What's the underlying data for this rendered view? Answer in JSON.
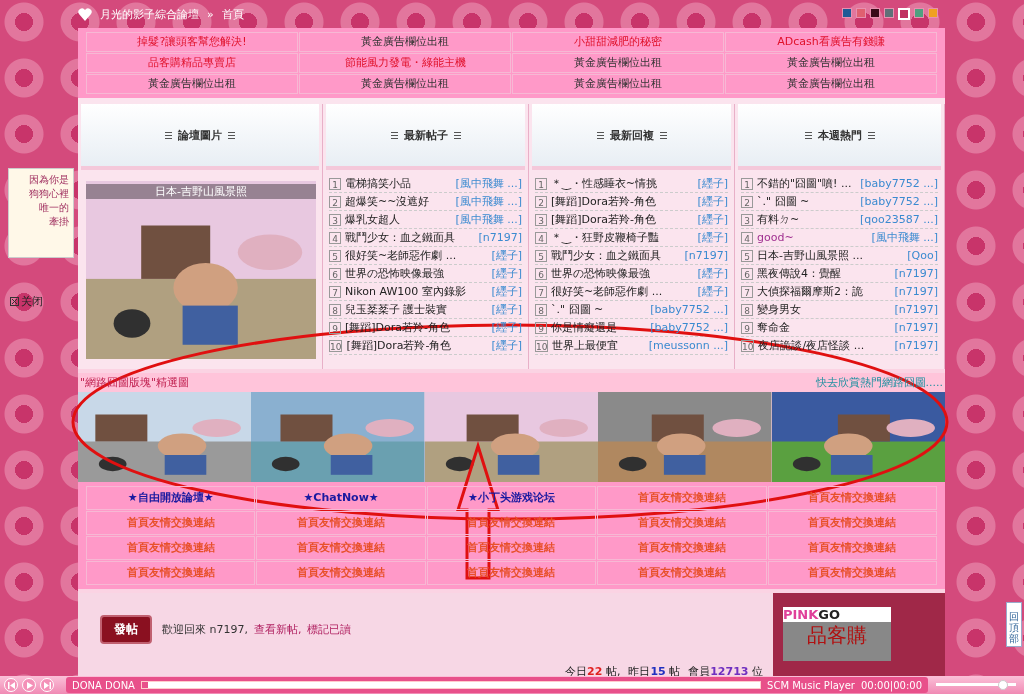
{
  "breadcrumb": {
    "site": "月光的影子綜合論壇",
    "separator": "»",
    "page": "首頁"
  },
  "swatches": [
    {
      "color": "#1f5a96",
      "selected": false
    },
    {
      "color": "#e06070",
      "selected": false
    },
    {
      "color": "#3a0a18",
      "selected": false
    },
    {
      "color": "#607078",
      "selected": false
    },
    {
      "color": "#c03060",
      "selected": true
    },
    {
      "color": "#50a080",
      "selected": false
    },
    {
      "color": "#f0a020",
      "selected": false
    }
  ],
  "ads": [
    {
      "text": "掉髮?讓頭客幫您解決!",
      "highlight": true
    },
    {
      "text": "黃金廣告欄位出租",
      "highlight": false
    },
    {
      "text": "小甜甜減肥的秘密",
      "highlight": true
    },
    {
      "text": "ADcash看廣告有錢賺",
      "highlight": true
    },
    {
      "text": "品客購精品專賣店",
      "highlight": true
    },
    {
      "text": "節能風力發電・綠能主機",
      "highlight": true
    },
    {
      "text": "黃金廣告欄位出租",
      "highlight": false
    },
    {
      "text": "黃金廣告欄位出租",
      "highlight": false
    },
    {
      "text": "黃金廣告欄位出租",
      "highlight": false
    },
    {
      "text": "黃金廣告欄位出租",
      "highlight": false
    },
    {
      "text": "黃金廣告欄位出租",
      "highlight": false
    },
    {
      "text": "黃金廣告欄位出租",
      "highlight": false
    }
  ],
  "float_ad": {
    "lines": [
      "因為你是",
      "狗狗心裡",
      "唯一的",
      "牽掛"
    ],
    "close": "关闭"
  },
  "photo_panel": {
    "title": "論壇圖片",
    "caption": "日本-吉野山風景照"
  },
  "lists": [
    {
      "title": "最新帖子",
      "items": [
        {
          "rank": "1",
          "title": "電梯搞笑小品",
          "author": "[風中飛舞 ...]",
          "visited": false
        },
        {
          "rank": "2",
          "title": "超爆笑~~沒遮好",
          "author": "[風中飛舞 ...]",
          "visited": false
        },
        {
          "rank": "3",
          "title": "爆乳女超人",
          "author": "[風中飛舞 ...]",
          "visited": false
        },
        {
          "rank": "4",
          "title": "戰鬥少女：血之鐵面具",
          "author": "[n7197]",
          "visited": false
        },
        {
          "rank": "5",
          "title": "很好笑~老師惡作劇 ...",
          "author": "[纆子]",
          "visited": false
        },
        {
          "rank": "6",
          "title": "世界の恐怖映像最強",
          "author": "[纆子]",
          "visited": false
        },
        {
          "rank": "7",
          "title": "Nikon AW100 室內錄影",
          "author": "[纆子]",
          "visited": false
        },
        {
          "rank": "8",
          "title": "兒玉棻棻子 護士裝實",
          "author": "[纆子]",
          "visited": false
        },
        {
          "rank": "9",
          "title": "[舞蹈]Dora若羚-角色",
          "author": "[纆子]",
          "visited": false
        },
        {
          "rank": "10",
          "title": "[舞蹈]Dora若羚-角色",
          "author": "[纆子]",
          "visited": false
        }
      ]
    },
    {
      "title": "最新回複",
      "items": [
        {
          "rank": "1",
          "title": "＊‿・性感睡衣~情挑",
          "author": "[纆子]",
          "visited": false
        },
        {
          "rank": "2",
          "title": "[舞蹈]Dora若羚-角色",
          "author": "[纆子]",
          "visited": false
        },
        {
          "rank": "3",
          "title": "[舞蹈]Dora若羚-角色",
          "author": "[纆子]",
          "visited": false
        },
        {
          "rank": "4",
          "title": "＊‿・狂野皮鞭椅子豔",
          "author": "[纆子]",
          "visited": false
        },
        {
          "rank": "5",
          "title": "戰鬥少女：血之鐵面具",
          "author": "[n7197]",
          "visited": false
        },
        {
          "rank": "6",
          "title": "世界の恐怖映像最強",
          "author": "[纆子]",
          "visited": false
        },
        {
          "rank": "7",
          "title": "很好笑~老師惡作劇 ...",
          "author": "[纆子]",
          "visited": false
        },
        {
          "rank": "8",
          "title": "`.\" 囧圖 ~",
          "author": "[baby7752 ...]",
          "visited": false
        },
        {
          "rank": "9",
          "title": "你是情癡還是",
          "author": "[baby7752 ...]",
          "visited": false
        },
        {
          "rank": "10",
          "title": "世界上最便宜",
          "author": "[meussonn ...]",
          "visited": false
        }
      ]
    },
    {
      "title": "本週熱門",
      "items": [
        {
          "rank": "1",
          "title": "不錯的\"囧圖\"噴! ...",
          "author": "[baby7752 ...]",
          "visited": false
        },
        {
          "rank": "2",
          "title": "`.\" 囧圖 ~",
          "author": "[baby7752 ...]",
          "visited": false
        },
        {
          "rank": "3",
          "title": "有料ㄉ~",
          "author": "[qoo23587 ...]",
          "visited": false
        },
        {
          "rank": "4",
          "title": "good~",
          "author": "[風中飛舞 ...]",
          "visited": true
        },
        {
          "rank": "5",
          "title": "日本-吉野山風景照 ...",
          "author": "[Qoo]",
          "visited": false
        },
        {
          "rank": "6",
          "title": "黑夜傳說4：覺醒",
          "author": "[n7197]",
          "visited": false
        },
        {
          "rank": "7",
          "title": "大偵探福爾摩斯2：詭",
          "author": "[n7197]",
          "visited": false
        },
        {
          "rank": "8",
          "title": "變身男女",
          "author": "[n7197]",
          "visited": false
        },
        {
          "rank": "9",
          "title": "奪命金",
          "author": "[n7197]",
          "visited": false
        },
        {
          "rank": "10",
          "title": "夜店詭談/夜店怪談 ...",
          "author": "[n7197]",
          "visited": false
        }
      ]
    }
  ],
  "gallery": {
    "title": "\"網路囧圖版塊\"精選圖",
    "more": "快去欣賞熱門網路囧圖....."
  },
  "links": [
    {
      "text": "★自由開放論壇★",
      "kind": "featured"
    },
    {
      "text": "★ChatNow★",
      "kind": "featured"
    },
    {
      "text": "★小丁头游戏论坛",
      "kind": "featured"
    },
    {
      "text": "首頁友情交換連結",
      "kind": "exchange"
    },
    {
      "text": "首頁友情交換連結",
      "kind": "exchange"
    },
    {
      "text": "首頁友情交換連結",
      "kind": "exchange"
    },
    {
      "text": "首頁友情交換連結",
      "kind": "exchange"
    },
    {
      "text": "首頁友情交換連結",
      "kind": "exchange"
    },
    {
      "text": "首頁友情交換連結",
      "kind": "exchange"
    },
    {
      "text": "首頁友情交換連結",
      "kind": "exchange"
    },
    {
      "text": "首頁友情交換連結",
      "kind": "exchange"
    },
    {
      "text": "首頁友情交換連結",
      "kind": "exchange"
    },
    {
      "text": "首頁友情交換連結",
      "kind": "exchange"
    },
    {
      "text": "首頁友情交換連結",
      "kind": "exchange"
    },
    {
      "text": "首頁友情交換連結",
      "kind": "exchange"
    },
    {
      "text": "首頁友情交換連結",
      "kind": "exchange"
    },
    {
      "text": "首頁友情交換連結",
      "kind": "exchange"
    },
    {
      "text": "首頁友情交換連結",
      "kind": "exchange"
    },
    {
      "text": "首頁友情交換連結",
      "kind": "exchange"
    },
    {
      "text": "首頁友情交換連結",
      "kind": "exchange"
    }
  ],
  "footer": {
    "post_button": "發帖",
    "welcome": "歡迎回來 n7197,",
    "links": [
      "查看新帖,",
      "標記已讀"
    ],
    "stats": [
      {
        "label": "今日",
        "value": "22",
        "unit": "帖,",
        "color": "#e02020"
      },
      {
        "label": "昨日",
        "value": "15",
        "unit": "帖",
        "color": "#2030c0"
      },
      {
        "label": "會員",
        "value": "12713",
        "unit": "位",
        "color": "#7030c0"
      }
    ]
  },
  "sponsor": {
    "brand_pink": "PINK",
    "brand_dark": "GO",
    "name": "品客購"
  },
  "back_to_top": "回頂部",
  "player": {
    "track": "DONA DONA",
    "level": 0.01,
    "name": "SCM Music Player",
    "time": "00:00|00:00",
    "volume": {
      "level": 0.9
    }
  }
}
